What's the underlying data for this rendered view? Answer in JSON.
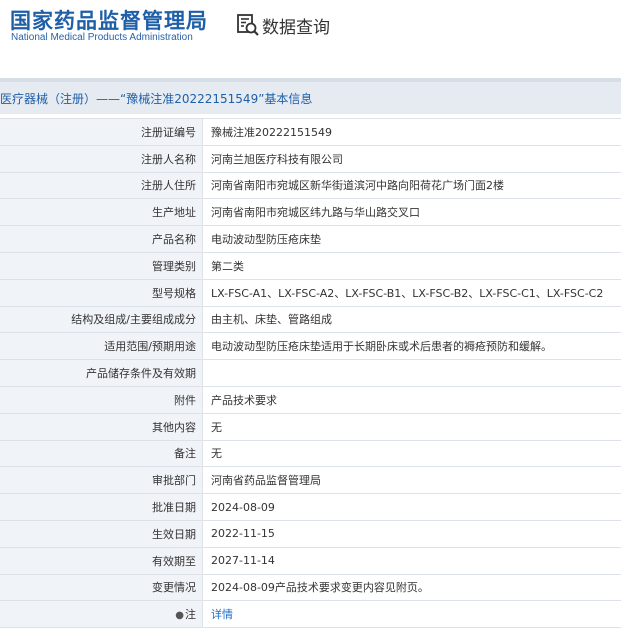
{
  "header": {
    "logo_cn": "国家药品监督管理局",
    "logo_en": "National Medical Products Administration",
    "query_label": "数据查询",
    "query_icon": "search-document-icon"
  },
  "title": "医疗器械（注册）——“豫械注准20222151549”基本信息",
  "rows": [
    {
      "label": "注册证编号",
      "value": "豫械注准20222151549"
    },
    {
      "label": "注册人名称",
      "value": "河南兰旭医疗科技有限公司"
    },
    {
      "label": "注册人住所",
      "value": "河南省南阳市宛城区新华街道滨河中路向阳荷花广场门面2楼"
    },
    {
      "label": "生产地址",
      "value": "河南省南阳市宛城区纬九路与华山路交叉口"
    },
    {
      "label": "产品名称",
      "value": "电动波动型防压疮床垫"
    },
    {
      "label": "管理类别",
      "value": "第二类"
    },
    {
      "label": "型号规格",
      "value": "LX-FSC-A1、LX-FSC-A2、LX-FSC-B1、LX-FSC-B2、LX-FSC-C1、LX-FSC-C2"
    },
    {
      "label": "结构及组成/主要组成成分",
      "value": "由主机、床垫、管路组成"
    },
    {
      "label": "适用范围/预期用途",
      "value": "电动波动型防压疮床垫适用于长期卧床或术后患者的褥疮预防和缓解。"
    },
    {
      "label": "产品储存条件及有效期",
      "value": ""
    },
    {
      "label": "附件",
      "value": "产品技术要求"
    },
    {
      "label": "其他内容",
      "value": "无"
    },
    {
      "label": "备注",
      "value": "无"
    },
    {
      "label": "审批部门",
      "value": "河南省药品监督管理局"
    },
    {
      "label": "批准日期",
      "value": "2024-08-09"
    },
    {
      "label": "生效日期",
      "value": "2022-11-15"
    },
    {
      "label": "有效期至",
      "value": "2027-11-14"
    },
    {
      "label": "变更情况",
      "value": "2024-08-09产品技术要求变更内容见附页。"
    }
  ],
  "note_row": {
    "label": "注",
    "link": "详情",
    "icon": "pin-icon"
  },
  "colors": {
    "brand": "#1e5fa8",
    "link": "#1e6dc8",
    "label_bg": "#f0f3f7",
    "title_bg": "#e6ebf2"
  }
}
